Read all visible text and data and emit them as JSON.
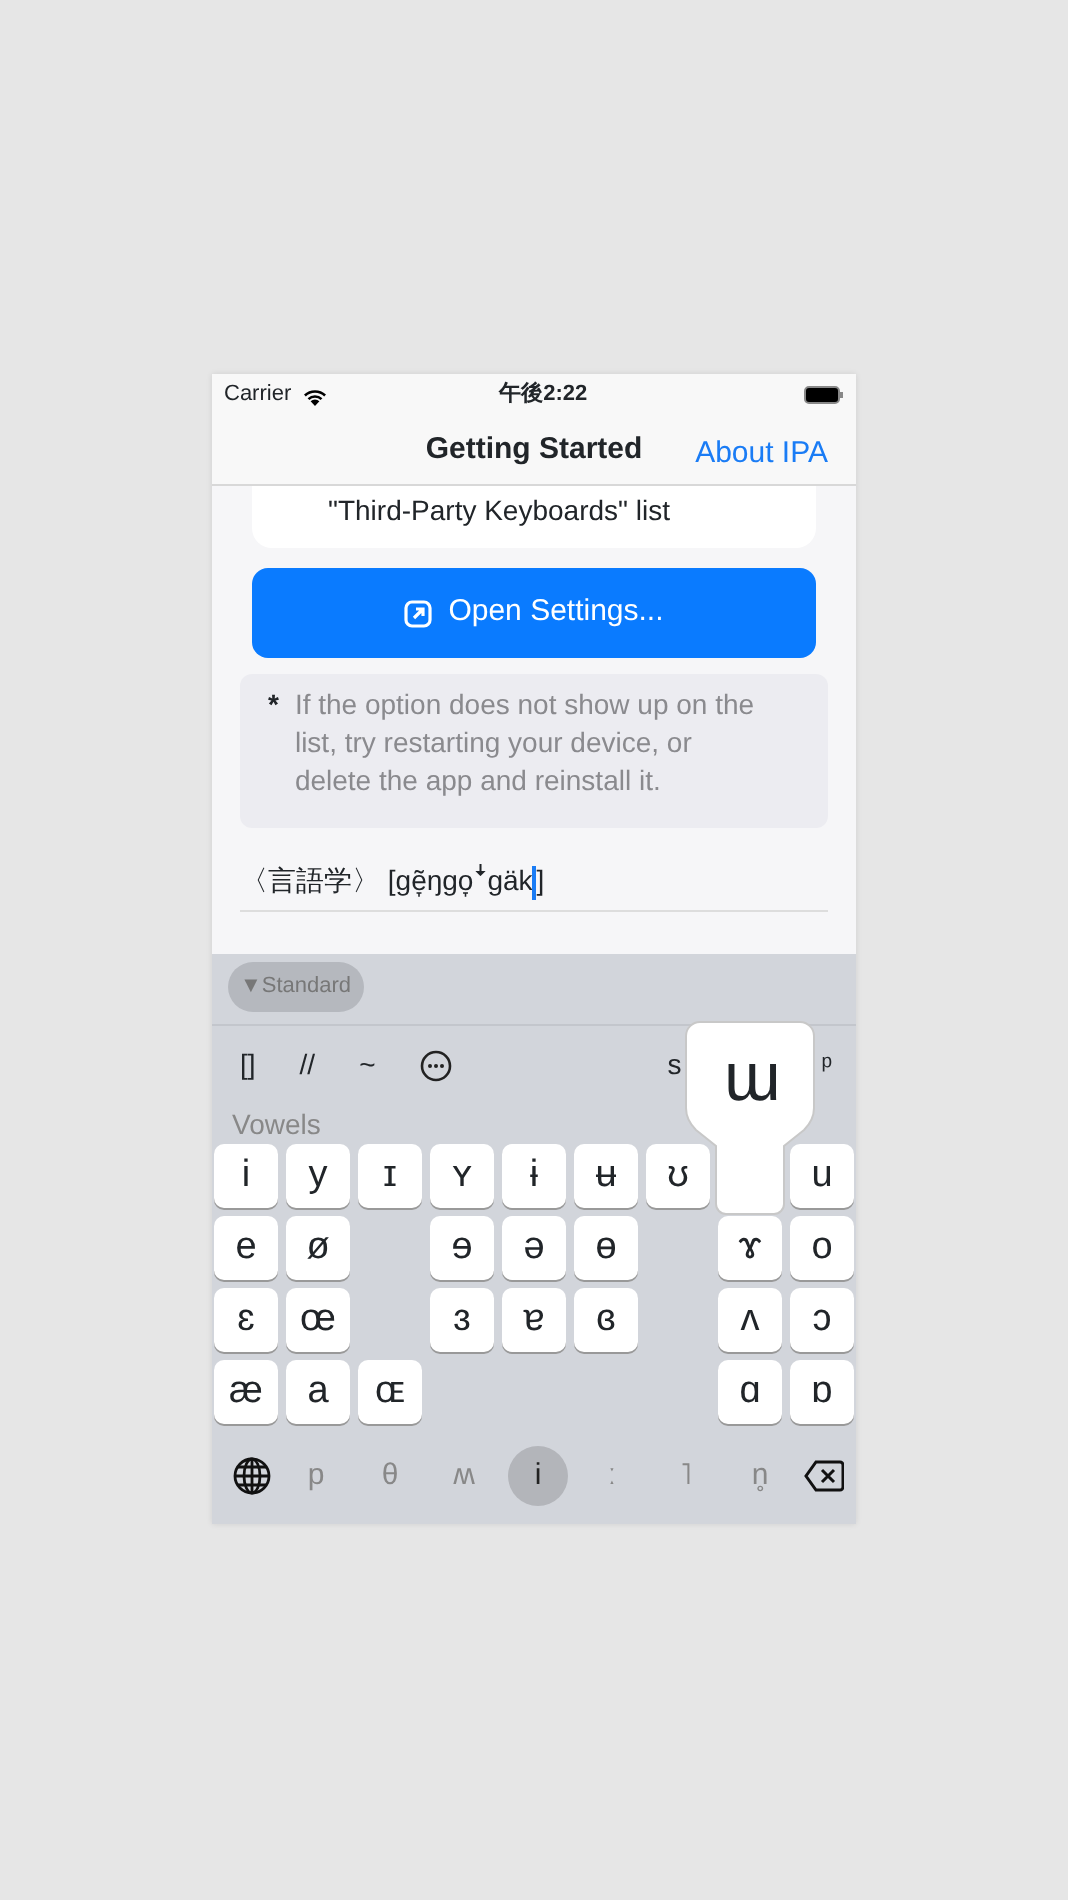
{
  "status_bar": {
    "carrier": "Carrier",
    "time": "午後2:22"
  },
  "nav": {
    "title": "Getting Started",
    "action": "About IPA"
  },
  "card_text": "\"Third-Party Keyboards\" list",
  "open_button": "Open Settings...",
  "note": {
    "mark": "*",
    "text": "If the option does not show up on the list, try restarting your device, or delete the app and reinstall it."
  },
  "input": {
    "before": "〈言語学〉 [gẽ̞ŋgo̞ꜜgäk",
    "after": "]"
  },
  "keyboard": {
    "layout_button": "▼Standard",
    "toolbar": [
      {
        "kind": "text",
        "label": "[]"
      },
      {
        "kind": "text",
        "label": "//"
      },
      {
        "kind": "text",
        "label": "~"
      },
      {
        "kind": "more"
      }
    ],
    "toolbar_right": [
      "s",
      "ᵖ"
    ],
    "section": "Vowels",
    "rows": [
      [
        {
          "label": "i"
        },
        {
          "label": "y"
        },
        {
          "label": "ɪ"
        },
        {
          "label": "ʏ"
        },
        {
          "label": "ɨ"
        },
        {
          "label": "ʉ"
        },
        {
          "label": "ʊ"
        },
        {
          "label": "ɯ",
          "pressed": true
        },
        {
          "label": "u"
        }
      ],
      [
        {
          "label": "e"
        },
        {
          "label": "ø"
        },
        null,
        {
          "label": "ɘ"
        },
        {
          "label": "ə"
        },
        {
          "label": "ɵ"
        },
        null,
        {
          "label": "ɤ"
        },
        {
          "label": "o"
        }
      ],
      [
        {
          "label": "ɛ"
        },
        {
          "label": "œ"
        },
        null,
        {
          "label": "ɜ"
        },
        {
          "label": "ɐ"
        },
        {
          "label": "ɞ"
        },
        null,
        {
          "label": "ʌ"
        },
        {
          "label": "ɔ"
        }
      ],
      [
        {
          "label": "æ"
        },
        {
          "label": "a"
        },
        {
          "label": "ɶ"
        },
        null,
        null,
        null,
        null,
        {
          "label": "ɑ"
        },
        {
          "label": "ɒ"
        }
      ]
    ],
    "bottom": [
      {
        "kind": "globe"
      },
      {
        "kind": "char",
        "label": "p",
        "selected": false
      },
      {
        "kind": "char",
        "label": "θ",
        "selected": false
      },
      {
        "kind": "char",
        "label": "ʍ",
        "selected": false
      },
      {
        "kind": "char",
        "label": "i",
        "selected": true
      },
      {
        "kind": "char",
        "label": "ː",
        "selected": false
      },
      {
        "kind": "char",
        "label": "˥",
        "selected": false
      },
      {
        "kind": "char",
        "label": "n̥",
        "selected": false
      },
      {
        "kind": "delete"
      }
    ]
  }
}
